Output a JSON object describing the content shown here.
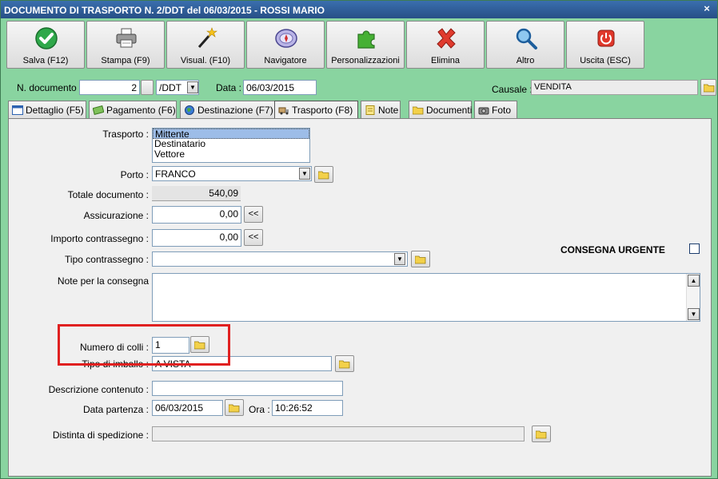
{
  "window": {
    "title": "DOCUMENTO DI TRASPORTO N. 2/DDT del 06/03/2015 - ROSSI MARIO",
    "close_glyph": "×"
  },
  "toolbar": {
    "buttons": [
      {
        "label": "Salva (F12)",
        "icon": "check-icon"
      },
      {
        "label": "Stampa (F9)",
        "icon": "printer-icon"
      },
      {
        "label": "Visual. (F10)",
        "icon": "magic-wand-icon"
      },
      {
        "label": "Navigatore",
        "icon": "compass-icon"
      },
      {
        "label": "Personalizzazioni",
        "icon": "puzzle-icon"
      },
      {
        "label": "Elimina",
        "icon": "delete-x-icon"
      },
      {
        "label": "Altro",
        "icon": "magnifier-icon"
      },
      {
        "label": "Uscita (ESC)",
        "icon": "power-icon"
      }
    ]
  },
  "header": {
    "doc_number_label": "N. documento :",
    "doc_number_value": "2",
    "doc_series_value": "/DDT",
    "date_label": "Data :",
    "date_value": "06/03/2015",
    "causale_label": "Causale :",
    "causale_value": "VENDITA"
  },
  "tabs": [
    {
      "label": "Dettaglio (F5)",
      "icon": "table-icon"
    },
    {
      "label": "Pagamento (F6)",
      "icon": "money-icon"
    },
    {
      "label": "Destinazione (F7)",
      "icon": "globe-icon"
    },
    {
      "label": "Trasporto (F8)",
      "icon": "truck-icon"
    },
    {
      "label": "Note",
      "icon": "note-icon"
    },
    {
      "label": "Documenti",
      "icon": "folder-icon"
    },
    {
      "label": "Foto",
      "icon": "camera-icon"
    }
  ],
  "form": {
    "trasporto_label": "Trasporto :",
    "trasporto_options": [
      "Mittente",
      "Destinatario",
      "Vettore"
    ],
    "porto_label": "Porto :",
    "porto_value": "FRANCO",
    "totale_label": "Totale documento :",
    "totale_value": "540,09",
    "assicurazione_label": "Assicurazione :",
    "assicurazione_value": "0,00",
    "importo_contr_label": "Importo contrassegno :",
    "importo_contr_value": "0,00",
    "copy_button_label": "<<",
    "tipo_contr_label": "Tipo contrassegno :",
    "tipo_contr_value": "",
    "consegna_urgente_label": "CONSEGNA URGENTE",
    "note_label": "Note per la consegna",
    "colli_label": "Numero di colli :",
    "colli_value": "1",
    "imballo_label": "Tipo di imballo :",
    "imballo_value": "A VISTA",
    "descrizione_label": "Descrizione contenuto :",
    "descrizione_value": "",
    "data_partenza_label": "Data partenza :",
    "data_partenza_value": "06/03/2015",
    "ora_label": "Ora :",
    "ora_value": "10:26:52",
    "distinta_label": "Distinta di spedizione :",
    "distinta_value": ""
  },
  "colors": {
    "window_bg": "#89d4a0",
    "titlebar": "#2f5f9e",
    "highlight": "#e02020"
  }
}
